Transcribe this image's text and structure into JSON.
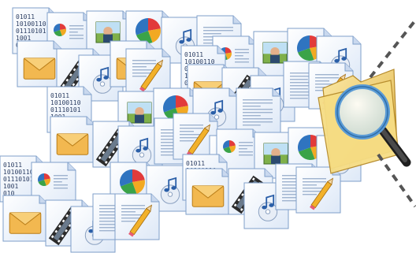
{
  "binary_lines": [
    "01011",
    "10100110",
    "01110101",
    "1001",
    "010"
  ],
  "icons": {
    "document": "document-icon",
    "binary": "binary-file-icon",
    "mail": "mail-icon",
    "film": "film-strip-icon",
    "music": "music-disc-icon",
    "chart": "pie-chart-icon",
    "image": "image-icon",
    "pencil": "pencil-icon",
    "folder": "folder-icon",
    "magnifier": "magnifier-icon"
  },
  "colors": {
    "paper": "#f4f8fe",
    "paper_edge": "#7f9fca",
    "envelope": "#f2b850",
    "folder": "#f3d26e",
    "lens_rim": "#5b9bd5",
    "dash": "#555555"
  }
}
